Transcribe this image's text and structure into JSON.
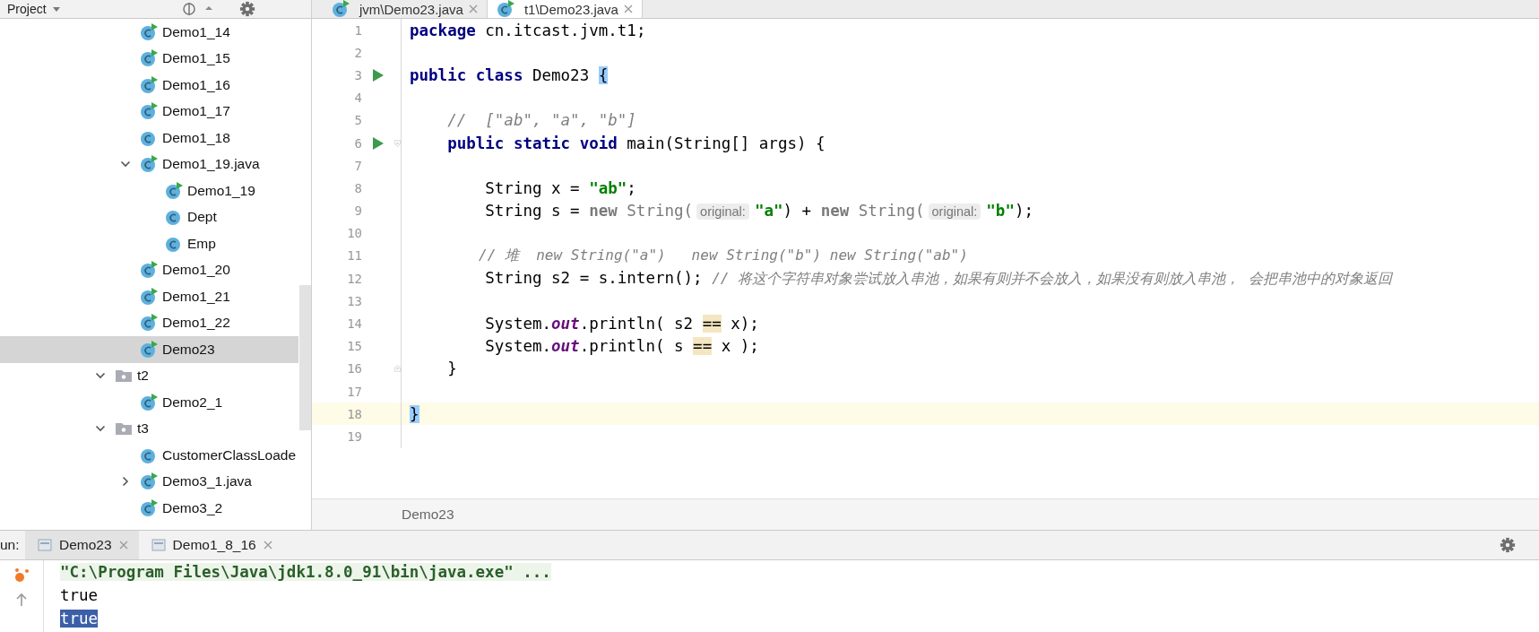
{
  "project_panel": {
    "title": "Project",
    "tree": {
      "items": [
        {
          "kind": "group",
          "children": [
            {
              "label": "Demo1_14",
              "kind": "class",
              "runnable": true,
              "selected": false
            },
            {
              "label": "Demo1_15",
              "kind": "class",
              "runnable": true,
              "selected": false
            },
            {
              "label": "Demo1_16",
              "kind": "class",
              "runnable": true,
              "selected": false
            },
            {
              "label": "Demo1_17",
              "kind": "class",
              "runnable": true,
              "selected": false
            },
            {
              "label": "Demo1_18",
              "kind": "class",
              "runnable": false,
              "selected": false
            },
            {
              "label": "Demo1_19.java",
              "kind": "class",
              "runnable": true,
              "selected": false,
              "expanded": true,
              "children": [
                {
                  "label": "Demo1_19",
                  "kind": "class",
                  "runnable": true,
                  "selected": false
                },
                {
                  "label": "Dept",
                  "kind": "class",
                  "runnable": false,
                  "selected": false
                },
                {
                  "label": "Emp",
                  "kind": "class",
                  "runnable": false,
                  "selected": false
                }
              ]
            },
            {
              "label": "Demo1_20",
              "kind": "class",
              "runnable": true,
              "selected": false
            },
            {
              "label": "Demo1_21",
              "kind": "class",
              "runnable": true,
              "selected": false
            },
            {
              "label": "Demo1_22",
              "kind": "class",
              "runnable": true,
              "selected": false
            },
            {
              "label": "Demo23",
              "kind": "class",
              "runnable": true,
              "selected": true
            }
          ]
        },
        {
          "label": "t2",
          "kind": "folder",
          "selected": false,
          "expanded": true,
          "children": [
            {
              "label": "Demo2_1",
              "kind": "class",
              "runnable": true,
              "selected": false
            }
          ]
        },
        {
          "label": "t3",
          "kind": "folder",
          "selected": false,
          "expanded": true,
          "children": [
            {
              "label": "CustomerClassLoade",
              "kind": "class",
              "runnable": false,
              "selected": false
            },
            {
              "label": "Demo3_1.java",
              "kind": "class",
              "runnable": true,
              "selected": false,
              "expanded": false
            },
            {
              "label": "Demo3_2",
              "kind": "class",
              "runnable": true,
              "selected": false
            }
          ]
        }
      ]
    }
  },
  "editor": {
    "tabs": [
      {
        "label": "jvm\\Demo23.java",
        "selected": false
      },
      {
        "label": "t1\\Demo23.java",
        "selected": true
      }
    ],
    "lines": [
      {
        "number": "1",
        "run": false,
        "fold_start": false,
        "fold_end": false,
        "current": false,
        "segments": [
          {
            "kind": "kw",
            "text": "package"
          },
          {
            "kind": "plain",
            "text": " cn.itcast.jvm.t1;"
          }
        ]
      },
      {
        "number": "2",
        "run": false,
        "fold_start": false,
        "fold_end": false,
        "current": false
      },
      {
        "number": "3",
        "run": true,
        "fold_start": false,
        "fold_end": false,
        "current": false,
        "segments": [
          {
            "kind": "kw",
            "text": "public class"
          },
          {
            "kind": "plain",
            "text": " Demo23 "
          },
          {
            "kind": "brace",
            "text": "{"
          }
        ]
      },
      {
        "number": "4",
        "run": false,
        "fold_start": false,
        "fold_end": false,
        "current": false
      },
      {
        "number": "5",
        "run": false,
        "fold_start": false,
        "fold_end": false,
        "current": false,
        "segments": [
          {
            "kind": "comment",
            "text": "    //  [\"ab\", \"a\", \"b\"]"
          }
        ]
      },
      {
        "number": "6",
        "run": true,
        "fold_start": true,
        "fold_end": false,
        "current": false,
        "segments": [
          {
            "kind": "kw",
            "text": "    public static void"
          },
          {
            "kind": "plain",
            "text": " main(String[] args) {"
          }
        ]
      },
      {
        "number": "7",
        "run": false,
        "fold_start": false,
        "fold_end": false,
        "current": false
      },
      {
        "number": "8",
        "run": false,
        "fold_start": false,
        "fold_end": false,
        "current": false,
        "segments": [
          {
            "kind": "plain",
            "text": "        String x = "
          },
          {
            "kind": "str",
            "text": "\"ab\""
          },
          {
            "kind": "plain",
            "text": ";"
          }
        ]
      },
      {
        "number": "9",
        "run": false,
        "fold_start": false,
        "fold_end": false,
        "current": false,
        "segments": [
          {
            "kind": "plain",
            "text": "        String s = "
          },
          {
            "kind": "kwdim",
            "text": "new"
          },
          {
            "kind": "dim",
            "text": " String("
          },
          {
            "kind": "hint",
            "text": "original:"
          },
          {
            "kind": "str",
            "text": "\"a\""
          },
          {
            "kind": "plain",
            "text": ") + "
          },
          {
            "kind": "kwdim",
            "text": "new"
          },
          {
            "kind": "dim",
            "text": " String("
          },
          {
            "kind": "hint",
            "text": "original:"
          },
          {
            "kind": "str",
            "text": "\"b\""
          },
          {
            "kind": "plain",
            "text": ");"
          }
        ]
      },
      {
        "number": "10",
        "run": false,
        "fold_start": false,
        "fold_end": false,
        "current": false
      },
      {
        "number": "11",
        "run": false,
        "fold_start": false,
        "fold_end": false,
        "current": false,
        "segments": [
          {
            "kind": "comment",
            "text": "        // 堆  new String(\"a\")   new String(\"b\") new String(\"ab\")"
          }
        ]
      },
      {
        "number": "12",
        "run": false,
        "fold_start": false,
        "fold_end": false,
        "current": false,
        "segments": [
          {
            "kind": "plain",
            "text": "        String s2 = s.intern(); "
          },
          {
            "kind": "comment",
            "text": "// 将这个字符串对象尝试放入串池，如果有则并不会放入，如果没有则放入串池， 会把串池中的对象返回"
          }
        ]
      },
      {
        "number": "13",
        "run": false,
        "fold_start": false,
        "fold_end": false,
        "current": false
      },
      {
        "number": "14",
        "run": false,
        "fold_start": false,
        "fold_end": false,
        "current": false,
        "segments": [
          {
            "kind": "plain",
            "text": "        System."
          },
          {
            "kind": "field",
            "text": "out"
          },
          {
            "kind": "plain",
            "text": ".println( s2 "
          },
          {
            "kind": "match",
            "text": "=="
          },
          {
            "kind": "plain",
            "text": " x);"
          }
        ]
      },
      {
        "number": "15",
        "run": false,
        "fold_start": false,
        "fold_end": false,
        "current": false,
        "segments": [
          {
            "kind": "plain",
            "text": "        System."
          },
          {
            "kind": "field",
            "text": "out"
          },
          {
            "kind": "plain",
            "text": ".println( s "
          },
          {
            "kind": "match",
            "text": "=="
          },
          {
            "kind": "plain",
            "text": " x );"
          }
        ]
      },
      {
        "number": "16",
        "run": false,
        "fold_start": false,
        "fold_end": true,
        "current": false,
        "segments": [
          {
            "kind": "plain",
            "text": "    }"
          }
        ]
      },
      {
        "number": "17",
        "run": false,
        "fold_start": false,
        "fold_end": false,
        "current": false
      },
      {
        "number": "18",
        "run": false,
        "fold_start": false,
        "fold_end": false,
        "current": true,
        "segments": [
          {
            "kind": "brace",
            "text": "}"
          }
        ]
      },
      {
        "number": "19",
        "run": false,
        "fold_start": false,
        "fold_end": false,
        "current": false
      }
    ],
    "breadcrumb": "Demo23"
  },
  "run_panel": {
    "label": "un:",
    "tabs": [
      {
        "label": "Demo23",
        "selected": true
      },
      {
        "label": "Demo1_8_16",
        "selected": false
      }
    ],
    "console": [
      {
        "kind": "command",
        "text": "\"C:\\Program Files\\Java\\jdk1.8.0_91\\bin\\java.exe\" ...",
        "selected": false
      },
      {
        "kind": "output",
        "text": "true",
        "selected": false
      },
      {
        "kind": "output",
        "text": "true",
        "selected": true
      }
    ]
  }
}
